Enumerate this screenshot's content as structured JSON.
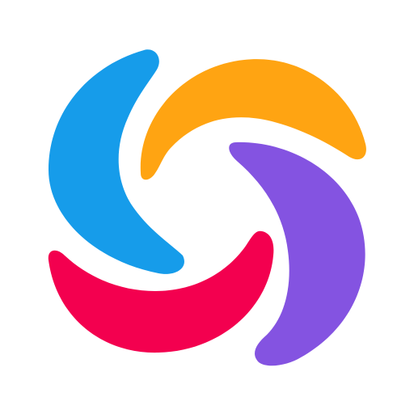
{
  "app_icon": {
    "icon": "pinwheel-logo-icon",
    "petals": [
      {
        "name": "blue-crescent",
        "color": "#169CEA"
      },
      {
        "name": "orange-crescent",
        "color": "#FFA412"
      },
      {
        "name": "purple-crescent",
        "color": "#8453E1"
      },
      {
        "name": "pink-crescent",
        "color": "#F3004F"
      }
    ]
  }
}
